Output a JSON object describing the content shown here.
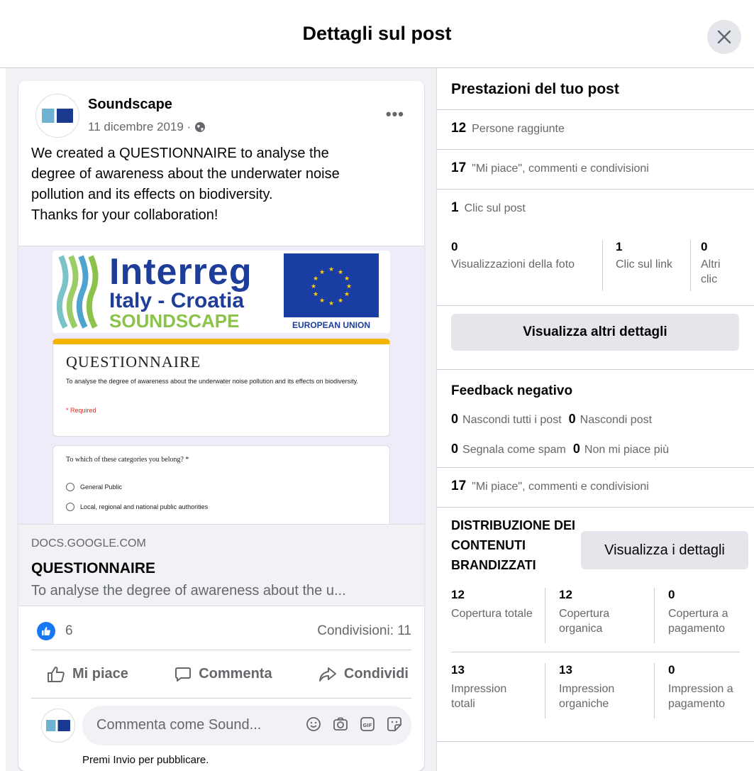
{
  "dialog": {
    "title": "Dettagli sul post"
  },
  "post": {
    "page_name": "Soundscape",
    "date": "11 dicembre 2019 ·",
    "text_lines": [
      "We created a QUESTIONNAIRE to analyse the",
      "degree of awareness about the underwater noise",
      "pollution and its effects on biodiversity.",
      "Thanks for your collaboration!"
    ],
    "more_label": "•••",
    "image": {
      "interreg": "Interreg",
      "italy_croatia": "Italy - Croatia",
      "soundscape": "SOUNDSCAPE",
      "european_union": "EUROPEAN UNION",
      "form_title": "QUESTIONNAIRE",
      "form_desc": "To analyse the degree of awareness about the underwater noise pollution and its effects on biodiversity.",
      "form_required": "* Required",
      "question": "To which of these categories you belong? *",
      "options": [
        "General Public",
        "Local, regional and national public authorities"
      ]
    },
    "link": {
      "domain": "DOCS.GOOGLE.COM",
      "title": "QUESTIONNAIRE",
      "description": "To analyse the degree of awareness about the u..."
    },
    "reactions_count": "6",
    "shares": "Condivisioni: 11",
    "actions": {
      "like": "Mi piace",
      "comment": "Commenta",
      "share": "Condividi"
    },
    "comment_placeholder": "Commenta come Sound...",
    "comment_hint": "Premi Invio per pubblicare."
  },
  "performance": {
    "title": "Prestazioni del tuo post",
    "reach": {
      "value": "12",
      "label": "Persone raggiunte"
    },
    "engagement": {
      "value": "17",
      "label": "\"Mi piace\", commenti e condivisioni"
    },
    "clicks": {
      "value": "1",
      "label": "Clic sul post"
    },
    "click_breakdown": [
      {
        "value": "0",
        "label": "Visualizzazioni della foto"
      },
      {
        "value": "1",
        "label": "Clic sul link"
      },
      {
        "value": "0",
        "label": "Altri clic"
      }
    ],
    "more_details_button": "Visualizza altri dettagli",
    "negative": {
      "title": "Feedback negativo",
      "hide_all": {
        "value": "0",
        "label": "Nascondi tutti i post"
      },
      "hide": {
        "value": "0",
        "label": "Nascondi post"
      },
      "spam": {
        "value": "0",
        "label": "Segnala come spam"
      },
      "unlike": {
        "value": "0",
        "label": "Non mi piace più"
      }
    },
    "engagement_2": {
      "value": "17",
      "label": "\"Mi piace\", commenti e condivisioni"
    },
    "branded": {
      "title": "DISTRIBUZIONE DEI CONTENUTI BRANDIZZATI",
      "details_button": "Visualizza i dettagli",
      "coverage": [
        {
          "value": "12",
          "label": "Copertura totale"
        },
        {
          "value": "12",
          "label": "Copertura organica"
        },
        {
          "value": "0",
          "label": "Copertura a pagamento"
        }
      ],
      "impressions": [
        {
          "value": "13",
          "label": "Impression totali"
        },
        {
          "value": "13",
          "label": "Impression organiche"
        },
        {
          "value": "0",
          "label": "Impression a pagamento"
        }
      ]
    }
  }
}
